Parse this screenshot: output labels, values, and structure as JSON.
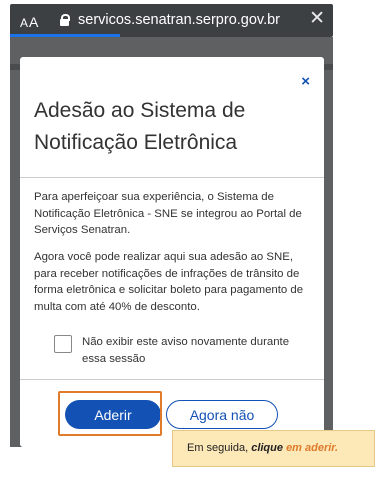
{
  "browser": {
    "aa_small": "A",
    "aa_large": "A",
    "url": "servicos.senatran.serpro.gov.br",
    "close_symbol": "✕"
  },
  "modal": {
    "close_symbol": "×",
    "title": "Adesão ao Sistema de Notificação Eletrônica",
    "paragraph1": "Para aperfeiçoar sua experiência, o Sistema de Notificação Eletrônica - SNE se integrou ao Portal de Serviços Senatran.",
    "paragraph2": "Agora você pode realizar aqui sua adesão ao SNE, para receber notificações de infrações de trânsito de forma eletrônica e solicitar boleto para pagamento de multa com até 40% de desconto.",
    "checkbox_label": "Não exibir este aviso novamente durante essa sessão",
    "checkbox_checked": false,
    "primary_button": "Aderir",
    "secondary_button": "Agora não"
  },
  "callout": {
    "prefix": "Em seguida, ",
    "emphasis": "clique",
    "middle": " ",
    "highlight": "em aderir",
    "suffix": "."
  },
  "colors": {
    "primary": "#1351b4",
    "highlight_border": "#e07b2b",
    "callout_bg": "#fde8b8"
  }
}
